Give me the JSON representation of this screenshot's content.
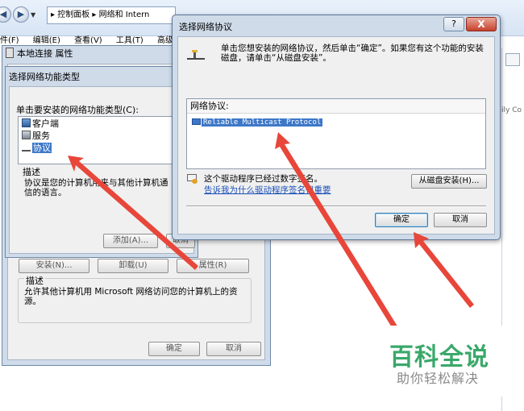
{
  "explorer": {
    "address_text": "▸ 控制面板 ▸ 网络和 Intern",
    "menu": [
      "件(F)",
      "编辑(E)",
      "查看(V)",
      "工具(T)",
      "高级("
    ],
    "right_fragment": "ily Co"
  },
  "local_props": {
    "title": "本地连接 属性",
    "install_label": "安装(N)...",
    "uninstall_label": "卸载(U)",
    "properties_label": "属性(R)",
    "desc_header": "描述",
    "desc_text": "允许其他计算机用 Microsoft 网络访问您的计算机上的资源。",
    "ok_label": "确定",
    "cancel_label": "取消"
  },
  "feature_dialog": {
    "title": "选择网络功能类型",
    "prompt": "单击要安装的网络功能类型(C):",
    "items": [
      "客户端",
      "服务",
      "协议"
    ],
    "selected_index": 2,
    "desc_header": "描述",
    "desc_text": "协议是您的计算机用来与其他计算机通信的语言。",
    "add_label": "添加(A)...",
    "cancel_label": "取消"
  },
  "protocol_dialog": {
    "title": "选择网络协议",
    "help_label": "?",
    "close_label": "X",
    "instruction": "单击您想安装的网络协议，然后单击“确定”。如果您有这个功能的安装磁盘，请单击“从磁盘安装”。",
    "list_header": "网络协议:",
    "protocols": [
      "Reliable Multicast Protocol"
    ],
    "signed_text": "这个驱动程序已经过数字签名。",
    "signing_link": "告诉我为什么驱动程序签名很重要",
    "have_disk_label": "从磁盘安装(H)...",
    "ok_label": "确定",
    "cancel_label": "取消"
  },
  "watermark": {
    "main": "百科全说",
    "sub": "助你轻松解决"
  },
  "colors": {
    "selection": "#3d78c8",
    "arrow": "#e8463a",
    "watermark_green": "#3aa86a"
  }
}
